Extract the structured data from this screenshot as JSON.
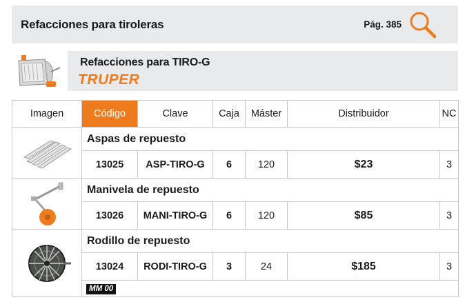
{
  "header": {
    "title": "Refacciones para tiroleras",
    "page_ref": "Pág. 385",
    "icon": "search-icon"
  },
  "product": {
    "title": "Refacciones para TIRO-G",
    "brand": "TRUPER",
    "image": "tirolera-machine"
  },
  "table": {
    "columns": [
      "Imagen",
      "Código",
      "Clave",
      "Caja",
      "Máster",
      "Distribuidor",
      "NC"
    ],
    "active_column": "Código",
    "rows": [
      {
        "image": "aspas-blades",
        "description": "Aspas de repuesto",
        "codigo": "13025",
        "clave": "ASP-TIRO-G",
        "caja": "6",
        "master": "120",
        "distribuidor": "$23",
        "nc": "3"
      },
      {
        "image": "manivela-crank",
        "description": "Manivela de repuesto",
        "codigo": "13026",
        "clave": "MANI-TIRO-G",
        "caja": "6",
        "master": "120",
        "distribuidor": "$85",
        "nc": "3"
      },
      {
        "image": "rodillo-roller",
        "description": "Rodillo de repuesto",
        "codigo": "13024",
        "clave": "RODI-TIRO-G",
        "caja": "3",
        "master": "24",
        "distribuidor": "$185",
        "nc": "3"
      }
    ],
    "tag": "MM 00"
  },
  "colors": {
    "accent": "#ef7b1f",
    "header_bg": "#e9eaeb",
    "border": "#c8c8c8"
  }
}
